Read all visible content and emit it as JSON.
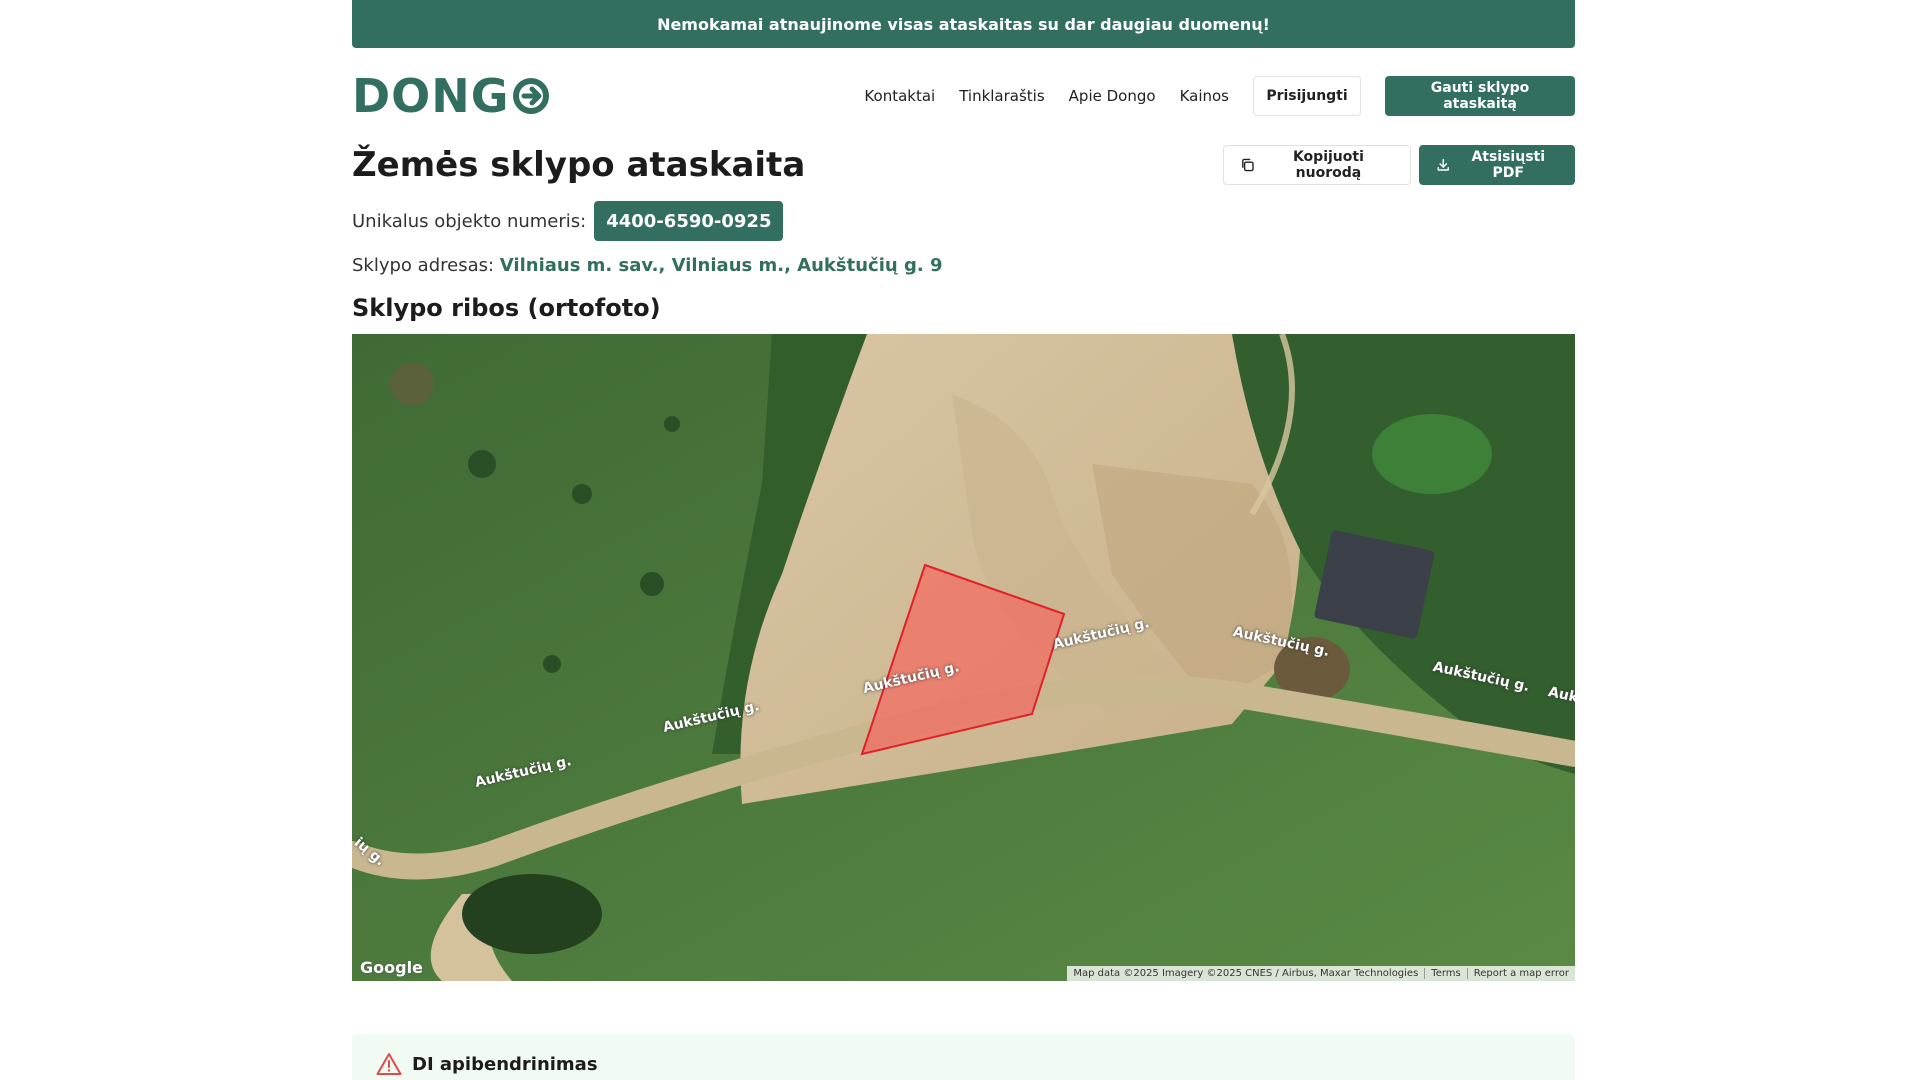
{
  "banner": {
    "text": "Nemokamai atnaujinome visas ataskaitas su dar daugiau duomenų!"
  },
  "header": {
    "logo_text": "DONG",
    "nav": [
      "Kontaktai",
      "Tinklaraštis",
      "Apie Dongo",
      "Kainos"
    ],
    "login_label": "Prisijungti",
    "cta_label": "Gauti sklypo ataskaitą"
  },
  "report": {
    "title": "Žemės sklypo ataskaita",
    "copy_label": "Kopijuoti nuorodą",
    "download_label": "Atsisiųsti PDF",
    "object_number_label": "Unikalus objekto numeris:",
    "object_number": "4400-6590-0925",
    "address_label": "Sklypo adresas:",
    "address": "Vilniaus m. sav., Vilniaus m., Aukštučių g. 9",
    "map_section_title": "Sklypo ribos (ortofoto)"
  },
  "map": {
    "street_labels": [
      "Aukštučių g.",
      "Aukštučių g.",
      "Aukštučių g.",
      "Aukštučių g.",
      "Aukštučių g.",
      "Aukštučių g.",
      "Auk",
      "ių g."
    ],
    "google_label": "Google",
    "credits": [
      "Map data ©2025 Imagery ©2025 CNES / Airbus, Maxar Technologies",
      "Terms",
      "Report a map error"
    ],
    "parcel_color": "#ff5050"
  },
  "ai_summary": {
    "title": "DI apibendrinimas"
  },
  "colors": {
    "brand": "#336f61",
    "ai_bg": "#f1fbf4",
    "warning": "#e04a4a"
  }
}
